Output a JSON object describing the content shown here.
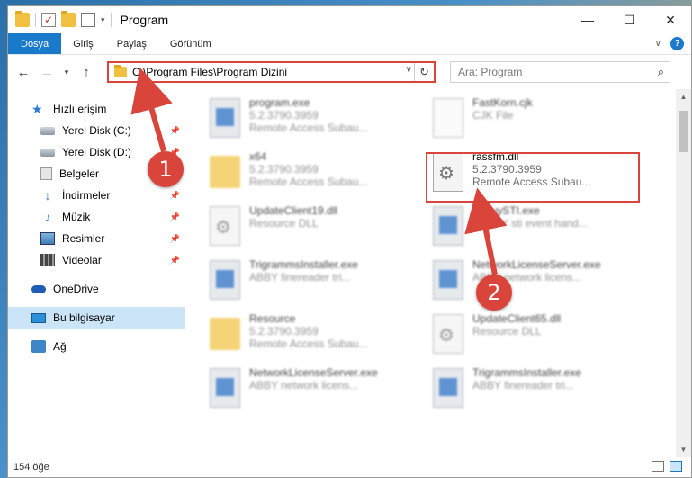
{
  "titlebar": {
    "title": "Program",
    "controls": [
      "—",
      "☐",
      "✕"
    ]
  },
  "ribbon": {
    "tabs": [
      "Dosya",
      "Giriş",
      "Paylaş",
      "Görünüm"
    ],
    "help": "?"
  },
  "navigation": {
    "back": "←",
    "forward": "→",
    "recent": "▾",
    "up": "↑"
  },
  "address": {
    "path": "C:\\Program Files\\Program Dizini",
    "refresh": "↻"
  },
  "search": {
    "placeholder": "Ara: Program"
  },
  "sidebar": {
    "items": [
      {
        "label": "Hızlı erişim",
        "icon": "star-icon"
      },
      {
        "label": "Yerel Disk (C:)",
        "icon": "disk-icon",
        "pinned": true
      },
      {
        "label": "Yerel Disk (D:)",
        "icon": "disk-icon",
        "pinned": true
      },
      {
        "label": "Belgeler",
        "icon": "documents-icon",
        "pinned": true
      },
      {
        "label": "İndirmeler",
        "icon": "download-icon",
        "pinned": true
      },
      {
        "label": "Müzik",
        "icon": "music-icon",
        "pinned": true
      },
      {
        "label": "Resimler",
        "icon": "pictures-icon",
        "pinned": true
      },
      {
        "label": "Videolar",
        "icon": "videos-icon",
        "pinned": true
      },
      {
        "label": "OneDrive",
        "icon": "cloud-icon"
      },
      {
        "label": "Bu bilgisayar",
        "icon": "computer-icon",
        "selected": true
      },
      {
        "label": "Ağ",
        "icon": "network-icon"
      }
    ]
  },
  "files": [
    {
      "name": "program.exe",
      "line1": "5.2.3790.3959",
      "line2": "Remote Access Subau...",
      "type": "exe"
    },
    {
      "name": "FastKorn.cjk",
      "line1": "CJK File",
      "line2": "",
      "type": "cjk"
    },
    {
      "name": "x64",
      "line1": "5.2.3790.3959",
      "line2": "Remote Access Subau...",
      "type": "folder"
    },
    {
      "name": "rassfm.dll",
      "line1": "5.2.3790.3959",
      "line2": "Remote Access Subau...",
      "type": "dll"
    },
    {
      "name": "UpdateClient19.dll",
      "line1": "Resource DLL",
      "line2": "",
      "type": "dll"
    },
    {
      "name": "AbbyySTI.exe",
      "line1": "ABBYY sti event hand...",
      "line2": "",
      "type": "exe"
    },
    {
      "name": "TrigrammsInstaller.exe",
      "line1": "ABBY finereader tri...",
      "line2": "",
      "type": "exe"
    },
    {
      "name": "NetworkLicenseServer.exe",
      "line1": "ABBY network licens...",
      "line2": "",
      "type": "exe"
    },
    {
      "name": "Resource",
      "line1": "5.2.3790.3959",
      "line2": "Remote Access Subau...",
      "type": "folder"
    },
    {
      "name": "UpdateClient65.dll",
      "line1": "Resource DLL",
      "line2": "",
      "type": "dll"
    },
    {
      "name": "NetworkLicenseServer.exe",
      "line1": "ABBY network licens...",
      "line2": "",
      "type": "exe"
    },
    {
      "name": "TrigrammsInstaller.exe",
      "line1": "ABBY finereader tri...",
      "line2": "",
      "type": "exe"
    }
  ],
  "annotations": {
    "marker1": "1",
    "marker2": "2",
    "color": "#d9453b"
  },
  "status": {
    "count": "154 öğe"
  },
  "colors": {
    "accent": "#1979ca",
    "selection": "#cce4f7",
    "highlight": "#d9453b"
  }
}
